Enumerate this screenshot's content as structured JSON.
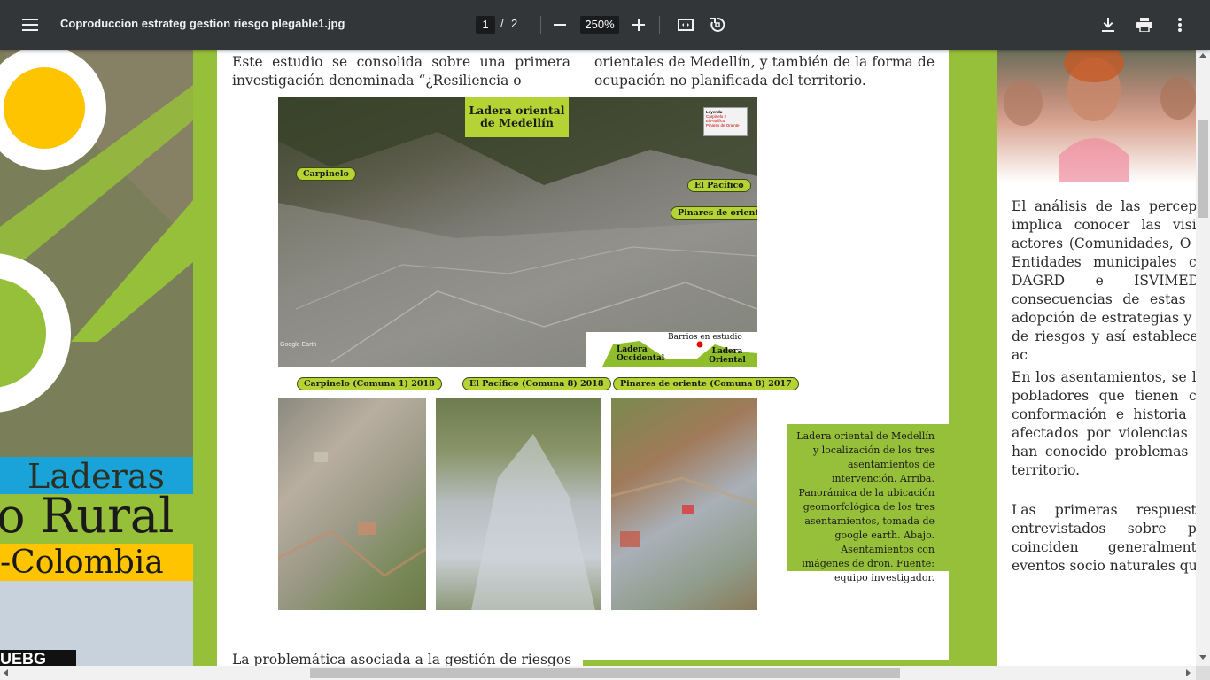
{
  "toolbar": {
    "title": "Coproduccion estrateg gestion riesgo plegable1.jpg",
    "page_current": "1",
    "page_separator": "/",
    "page_total": "2",
    "zoom": "250%"
  },
  "left_panel": {
    "banner_line1": "Laderas",
    "banner_line2": "o Rural",
    "banner_line3": "-Colombia",
    "logo_fragment": "UEBG"
  },
  "main": {
    "col1_top": "Este estudio se consolida sobre una primera investigación denominada “¿Resiliencia o",
    "col2_top": "orientales de Medellín, y también de la forma de ocupación no planificada del territorio.",
    "col1_bottom": "La problemática asociada a la gestión de riesgos",
    "map_title": "Ladera oriental de Medellín",
    "map_label_carpinelo": "Carpinelo",
    "map_label_pacifico": "El Pacífico",
    "map_label_pinares": "Pinares de oriente",
    "legend_title": "Leyenda",
    "legend_items": [
      "Carpinelo 2",
      "El Pacífico",
      "Pinares de Oriente"
    ],
    "profile_title": "Barrios en estudio",
    "profile_left": "Ladera Occidental",
    "profile_right": "Ladera Oriental",
    "google_earth": "Google Earth",
    "photo_labels": [
      "Carpinelo (Comuna 1) 2018",
      "El Pacífico (Comuna 8) 2018",
      "Pinares de oriente (Comuna 8) 2017"
    ],
    "caption": "Ladera oriental de Medellín y localización de los tres asentamientos de intervención. Arriba. Panorámica de la ubicación geomorfológica de los tres asentamientos, tomada de google earth. Abajo. Asentamientos con imágenes de dron. Fuente: equipo investigador."
  },
  "right_panel": {
    "para1": "El análisis de las percepc implica conocer las visio actores (Comunidades, O y Entidades municipales co DAGRD e ISVIMED) consecuencias de estas p adopción de estrategias y a de riesgos y así establecer ac",
    "para2": "En los asentamientos, se lo pobladores que tienen co conformación e historia d afectados por violencias u han conocido problemas d territorio.",
    "para3": "Las primeras respuesta entrevistados sobre pe coinciden generalmente eventos socio naturales qu"
  },
  "colors": {
    "toolbar_bg": "#323639",
    "accent_green": "#97c03a",
    "label_green": "#b5d334",
    "banner_blue": "#1aa3d9",
    "banner_yellow": "#ffc400"
  },
  "icons": [
    "menu-icon",
    "zoom-out-icon",
    "zoom-in-icon",
    "fit-page-icon",
    "rotate-icon",
    "download-icon",
    "print-icon",
    "more-vert-icon"
  ]
}
